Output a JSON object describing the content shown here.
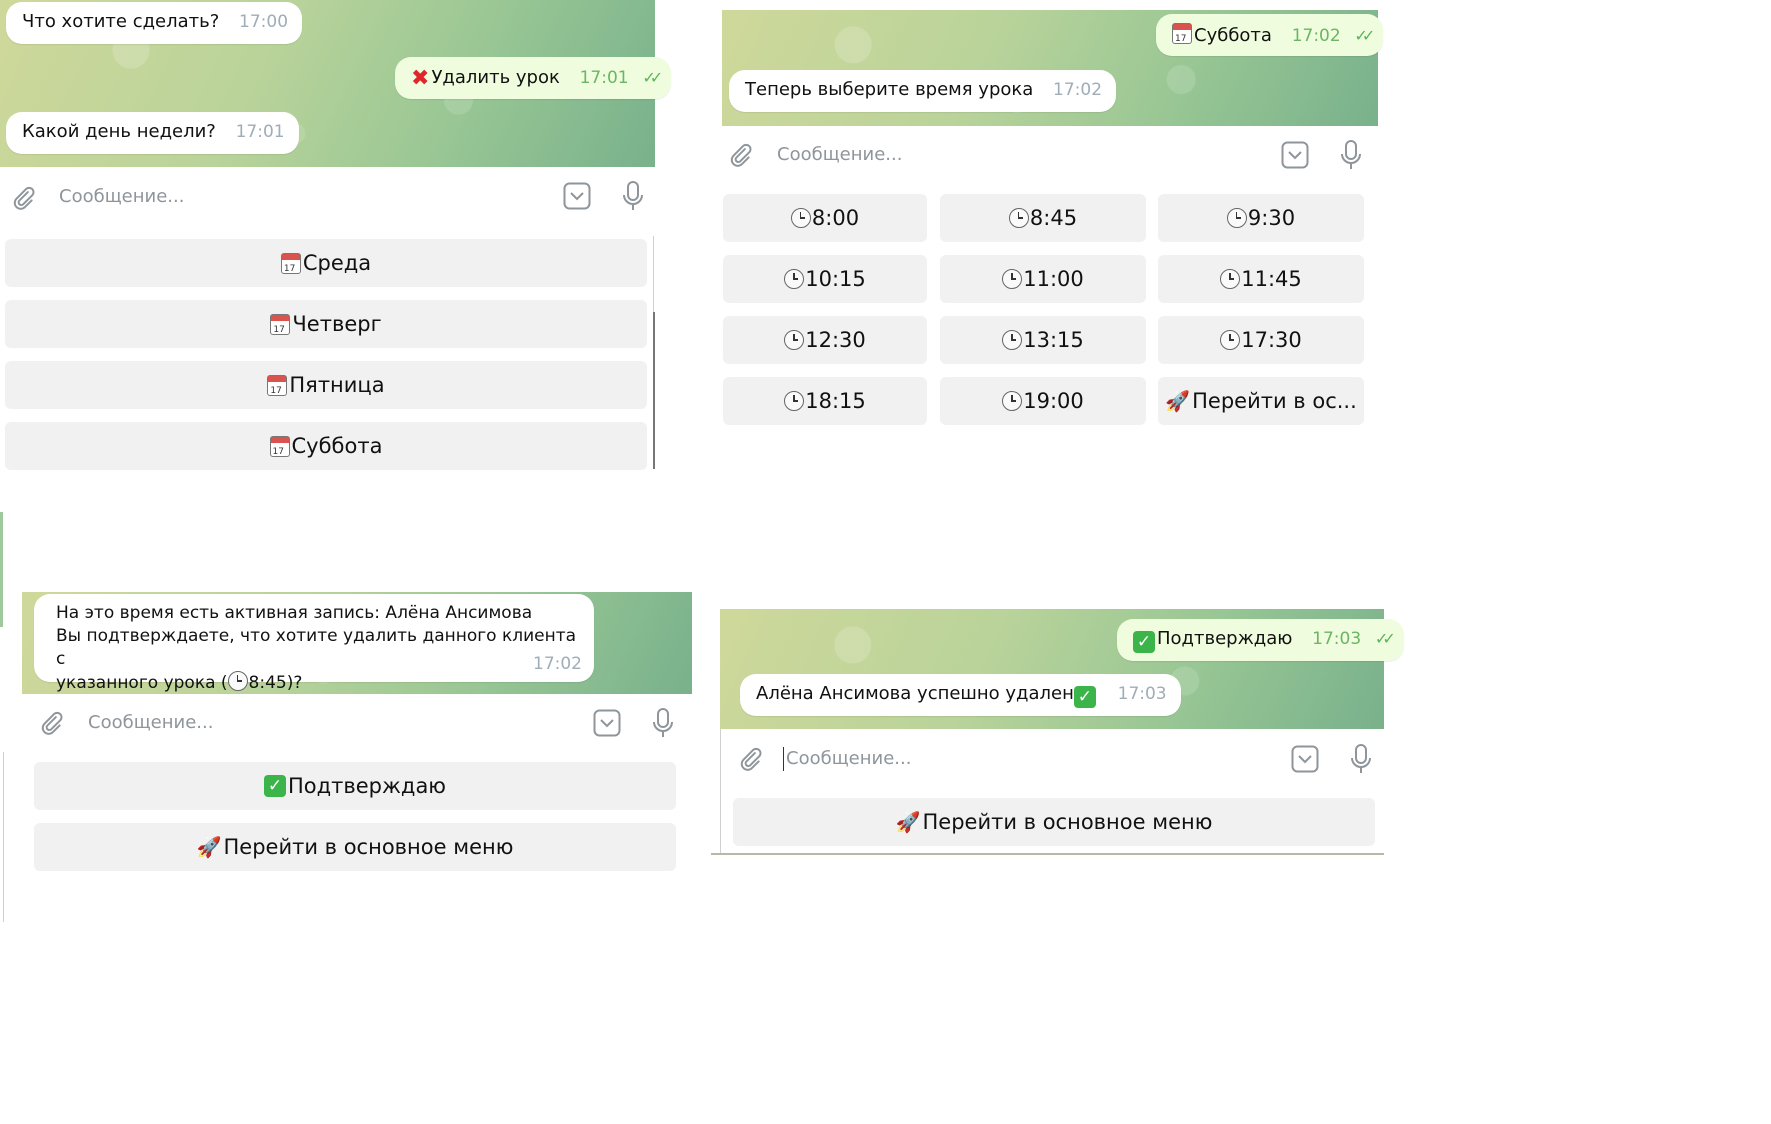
{
  "placeholder": "Сообщение...",
  "panel1": {
    "messages": [
      {
        "text": "Что хотите сделать?",
        "time": "17:00"
      },
      {
        "text": "Удалить урок",
        "time": "17:01"
      },
      {
        "text": "Какой день недели?",
        "time": "17:01"
      }
    ],
    "buttons": [
      "Среда",
      "Четверг",
      "Пятница",
      "Суббота"
    ]
  },
  "panel2": {
    "messages": [
      {
        "text": "Суббота",
        "time": "17:02"
      },
      {
        "text": "Теперь выберите время урока",
        "time": "17:02"
      }
    ],
    "buttons": [
      "8:00",
      "8:45",
      "9:30",
      "10:15",
      "11:00",
      "11:45",
      "12:30",
      "13:15",
      "17:30",
      "18:15",
      "19:00",
      "Перейти в ос..."
    ]
  },
  "panel3": {
    "message": {
      "line1": "На это время есть активная запись: Алёна Ансимова",
      "line2": "Вы подтверждаете, что хотите удалить данного клиента с",
      "line3_prefix": "указанного урока (",
      "line3_time": "8:45",
      "line3_suffix": ")?",
      "time": "17:02"
    },
    "buttons": [
      "Подтверждаю",
      "Перейти в основное меню"
    ]
  },
  "panel4": {
    "messages": [
      {
        "text": "Подтверждаю",
        "time": "17:03"
      },
      {
        "text": "Алёна Ансимова успешно удален",
        "time": "17:03"
      }
    ],
    "buttons": [
      "Перейти в основное меню"
    ]
  }
}
